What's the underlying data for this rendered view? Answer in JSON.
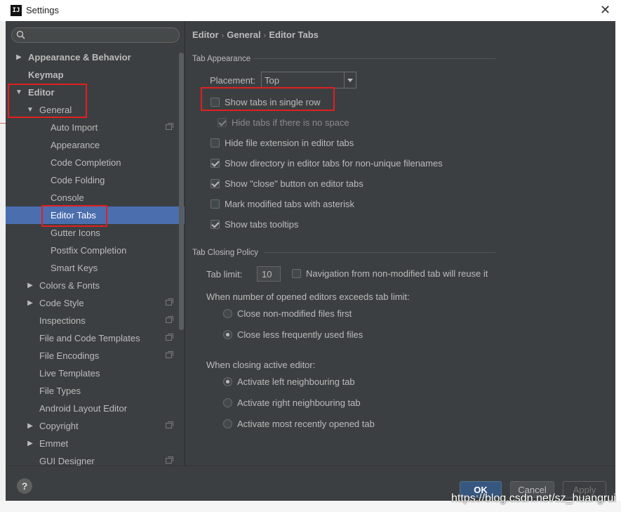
{
  "window": {
    "app_icon": "IJ",
    "title": "Settings",
    "close_label": "✕"
  },
  "sidebar": {
    "search_placeholder": "",
    "items": [
      {
        "label": "Appearance & Behavior",
        "expanded": false,
        "bold": true
      },
      {
        "label": "Keymap",
        "bold": true
      },
      {
        "label": "Editor",
        "expanded": true,
        "bold": true
      },
      {
        "label": "General",
        "expanded": true
      },
      {
        "label": "Auto Import",
        "project": true
      },
      {
        "label": "Appearance"
      },
      {
        "label": "Code Completion"
      },
      {
        "label": "Code Folding"
      },
      {
        "label": "Console"
      },
      {
        "label": "Editor Tabs",
        "selected": true
      },
      {
        "label": "Gutter Icons"
      },
      {
        "label": "Postfix Completion"
      },
      {
        "label": "Smart Keys"
      },
      {
        "label": "Colors & Fonts",
        "expanded": false
      },
      {
        "label": "Code Style",
        "expanded": false,
        "project": true
      },
      {
        "label": "Inspections",
        "project": true
      },
      {
        "label": "File and Code Templates",
        "project": true
      },
      {
        "label": "File Encodings",
        "project": true
      },
      {
        "label": "Live Templates"
      },
      {
        "label": "File Types"
      },
      {
        "label": "Android Layout Editor"
      },
      {
        "label": "Copyright",
        "expanded": false,
        "project": true
      },
      {
        "label": "Emmet",
        "expanded": false
      },
      {
        "label": "GUI Designer",
        "project": true
      }
    ]
  },
  "breadcrumb": [
    "Editor",
    "General",
    "Editor Tabs"
  ],
  "tab_appearance": {
    "group_title": "Tab Appearance",
    "placement_label": "Placement:",
    "placement_value": "Top",
    "options": [
      {
        "label": "Show tabs in single row",
        "checked": false
      },
      {
        "label": "Hide tabs if there is no space",
        "checked": true,
        "disabled": true
      },
      {
        "label": "Hide file extension in editor tabs",
        "checked": false
      },
      {
        "label": "Show directory in editor tabs for non-unique filenames",
        "checked": true
      },
      {
        "label": "Show \"close\" button on editor tabs",
        "checked": true
      },
      {
        "label": "Mark modified tabs with asterisk",
        "checked": false
      },
      {
        "label": "Show tabs tooltips",
        "checked": true
      }
    ]
  },
  "tab_closing": {
    "group_title": "Tab Closing Policy",
    "tab_limit_label": "Tab limit:",
    "tab_limit_value": "10",
    "nav_reuse_label": "Navigation from non-modified tab will reuse it",
    "nav_reuse_checked": false,
    "exceeds_label": "When number of opened editors exceeds tab limit:",
    "exceeds_options": [
      {
        "label": "Close non-modified files first",
        "checked": false
      },
      {
        "label": "Close less frequently used files",
        "checked": true
      }
    ],
    "closing_label": "When closing active editor:",
    "closing_options": [
      {
        "label": "Activate left neighbouring tab",
        "checked": true
      },
      {
        "label": "Activate right neighbouring tab",
        "checked": false
      },
      {
        "label": "Activate most recently opened tab",
        "checked": false
      }
    ]
  },
  "buttons": {
    "help": "?",
    "ok": "OK",
    "cancel": "Cancel",
    "apply": "Apply"
  },
  "watermark": "https://blog.csdn.net/sz_huangrui"
}
